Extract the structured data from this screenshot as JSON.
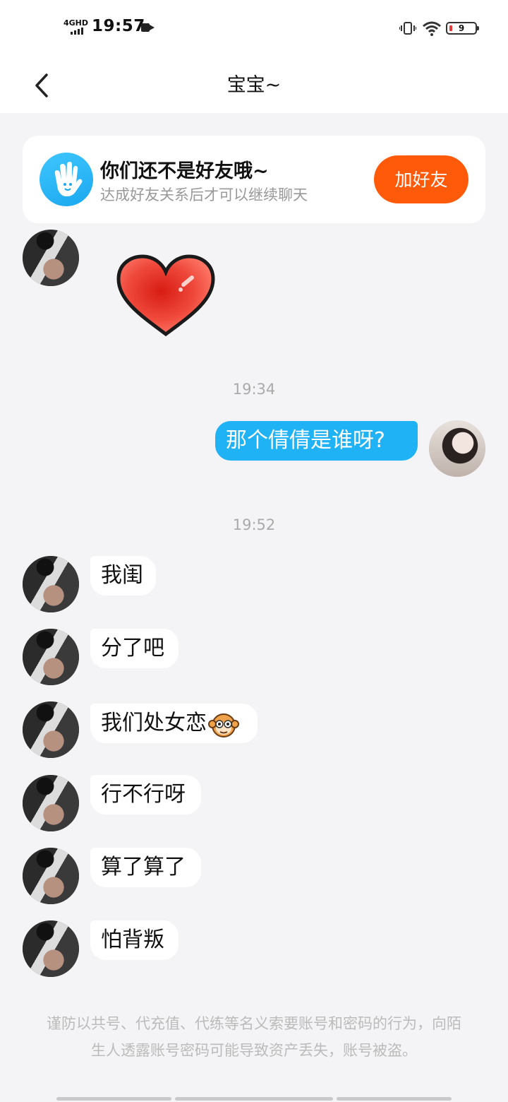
{
  "status": {
    "network": "4GHD",
    "time": "19:57",
    "battery": "9"
  },
  "header": {
    "title": "宝宝~"
  },
  "friend_card": {
    "title": "你们还不是好友哦~",
    "subtitle": "达成好友关系后才可以继续聊天",
    "button": "加好友"
  },
  "timestamps": [
    "19:34",
    "19:52"
  ],
  "messages": {
    "out_1": "那个倩倩是谁呀?",
    "in_1": "我闺",
    "in_2": "分了吧",
    "in_3": "我们处女恋",
    "in_4": "行不行呀",
    "in_5": "算了算了",
    "in_6": "怕背叛"
  },
  "notice": "谨防以共号、代充值、代练等名义索要账号和密码的行为，向陌生人透露账号密码可能导致资产丢失，账号被盗。",
  "colors": {
    "accent_blue": "#1fb3f5",
    "add_button": "#ff5a0a",
    "background": "#f4f4f6"
  }
}
